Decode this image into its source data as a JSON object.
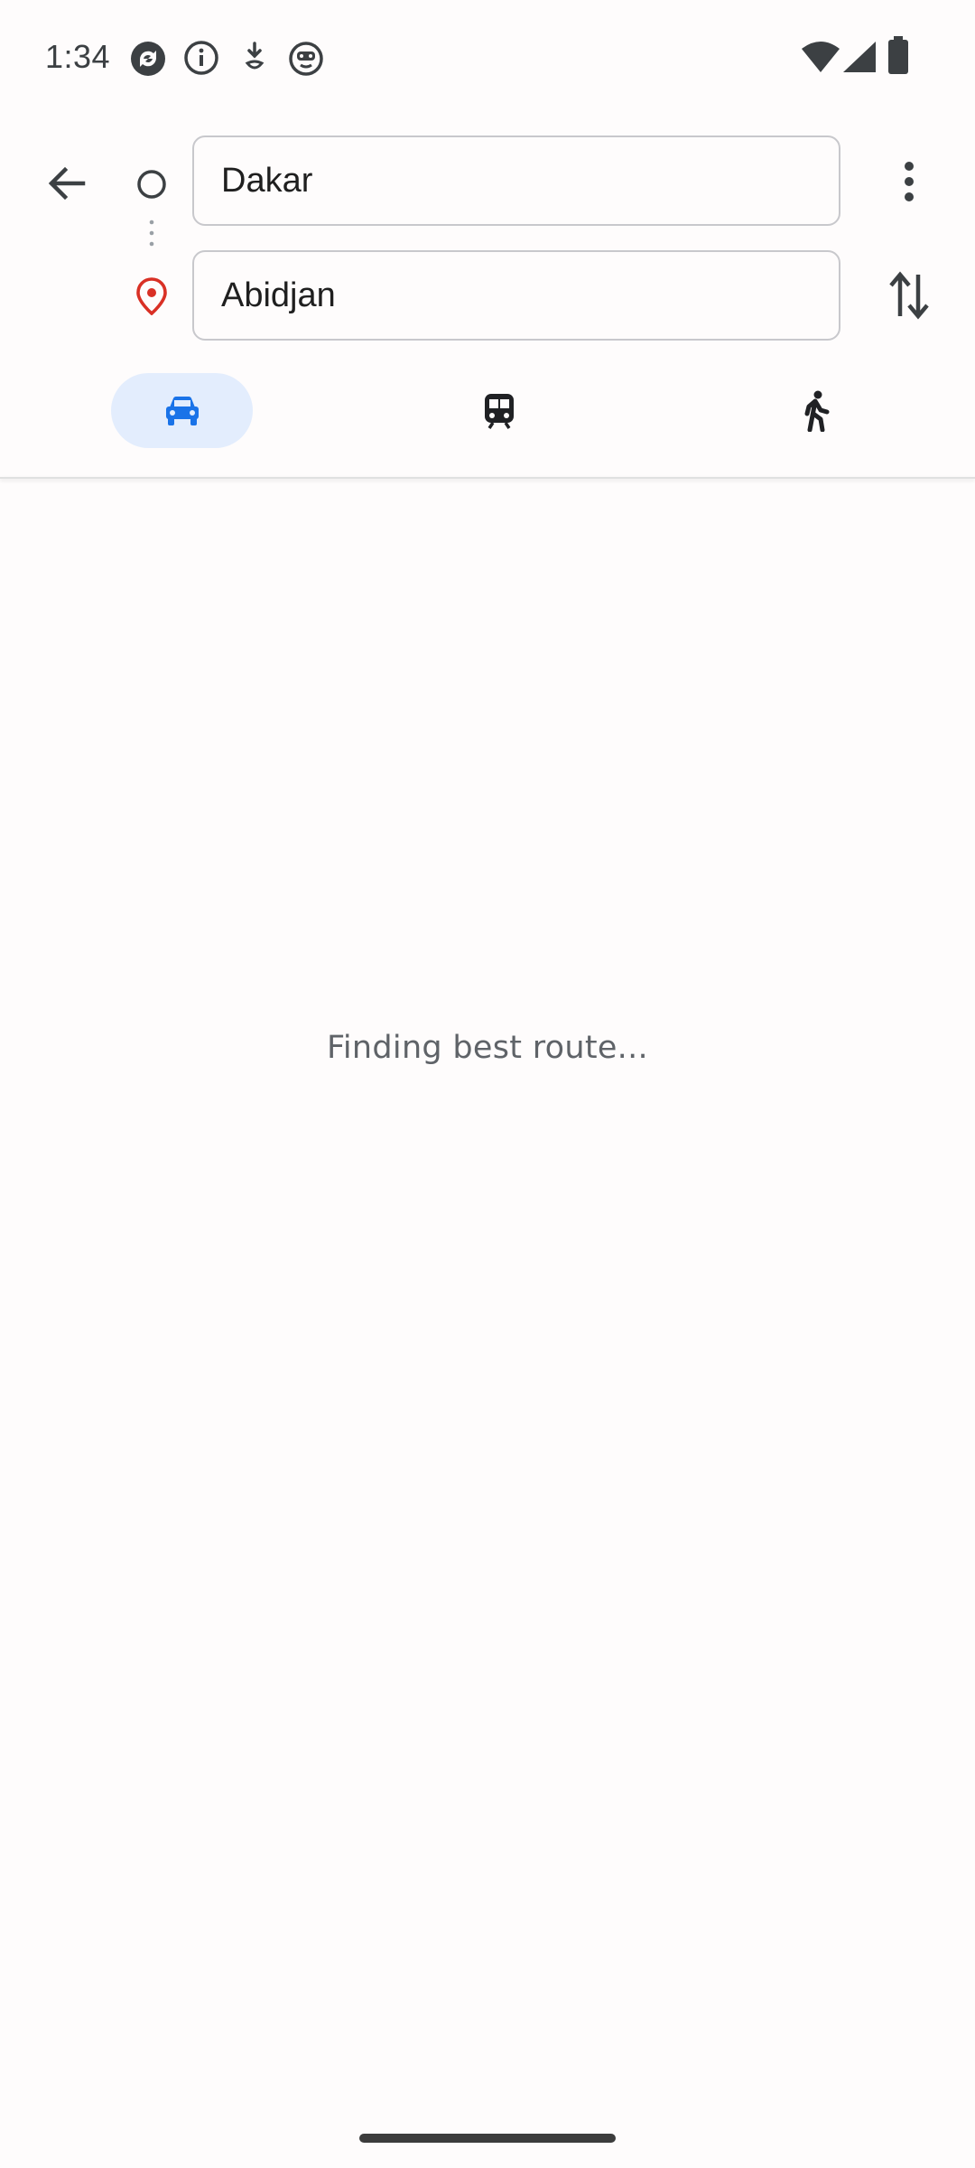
{
  "status_bar": {
    "time": "1:34",
    "icons_left": [
      "sync-icon",
      "info-icon",
      "download-arrow-icon",
      "bot-face-icon"
    ],
    "icons_right": [
      "wifi-icon",
      "cell-signal-icon",
      "battery-icon"
    ]
  },
  "directions": {
    "origin": {
      "value": "Dakar",
      "icon": "origin-circle-icon"
    },
    "destination": {
      "value": "Abidjan",
      "icon": "destination-pin-icon"
    },
    "back_icon": "arrow-back-icon",
    "more_icon": "more-vert-icon",
    "swap_icon": "swap-vert-icon"
  },
  "modes": [
    {
      "id": "drive",
      "icon": "car-icon",
      "selected": true
    },
    {
      "id": "transit",
      "icon": "train-icon",
      "selected": false
    },
    {
      "id": "walk",
      "icon": "walk-icon",
      "selected": false
    }
  ],
  "content": {
    "loading_text": "Finding best route..."
  },
  "colors": {
    "accent": "#1a73e8",
    "selected_tab_bg": "#e3edfd",
    "destination_pin": "#d93025"
  }
}
